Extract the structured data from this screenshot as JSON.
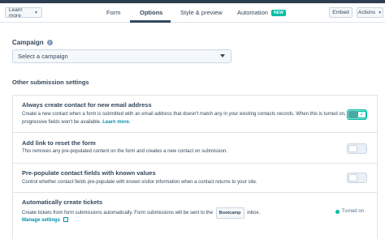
{
  "header": {
    "learn_more": "Learn more",
    "tabs": [
      {
        "label": "Form"
      },
      {
        "label": "Options"
      },
      {
        "label": "Style & preview"
      },
      {
        "label": "Automation"
      }
    ],
    "new_badge": "NEW",
    "embed": "Embed",
    "actions": "Actions"
  },
  "campaign": {
    "label": "Campaign",
    "select_value": "Select a campaign"
  },
  "other_settings": {
    "title": "Other submission settings",
    "rows": [
      {
        "title": "Always create contact for new email address",
        "desc": "Create a new contact when a form is submitted with an email address that doesn't match any in your existing contacts records. When this is turned on, progressive fields won't be available.",
        "link": "Learn more.",
        "enabled": true
      },
      {
        "title": "Add link to reset the form",
        "desc": "This removes any pre-populated content on the form and creates a new contact on submission.",
        "enabled": false
      },
      {
        "title": "Pre-populate contact fields with known values",
        "desc": "Control whether contact fields pre-populate with known visitor information when a contact returns to your site.",
        "enabled": false
      },
      {
        "title": "Automatically create tickets",
        "desc_before": "Create tickets from form submissions automatically. Form submissions will be sent to the",
        "pipeline": "Bootcamp",
        "desc_after": "inbox.",
        "manage": "Manage settings",
        "status": "Turned on"
      }
    ]
  },
  "colors": {
    "accent": "#00bda5",
    "link": "#0091ae",
    "text": "#33475b"
  }
}
